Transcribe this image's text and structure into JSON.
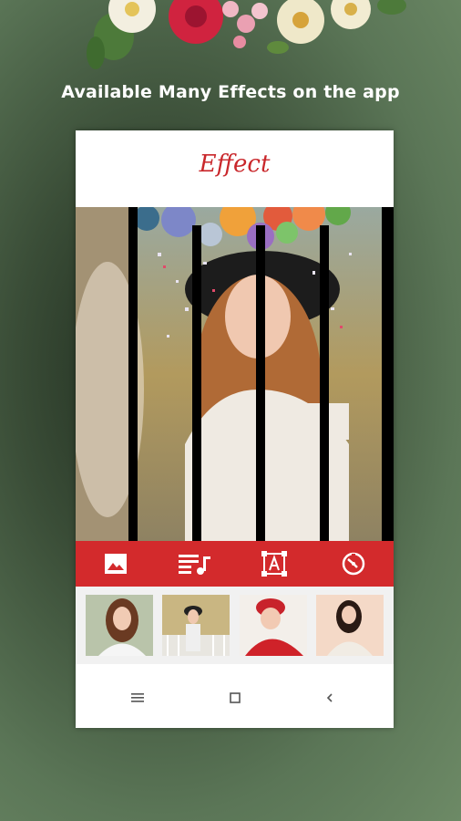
{
  "promo": {
    "headline": "Available Many Effects on the app"
  },
  "app": {
    "title": "Effect"
  },
  "toolbar": {
    "items": [
      {
        "icon": "image-icon"
      },
      {
        "icon": "music-list-icon"
      },
      {
        "icon": "text-frame-icon"
      },
      {
        "icon": "timer-icon"
      }
    ]
  },
  "thumbnails": [
    {
      "icon": "photo-thumbnail"
    },
    {
      "icon": "photo-thumbnail"
    },
    {
      "icon": "photo-thumbnail"
    },
    {
      "icon": "photo-thumbnail"
    }
  ],
  "navbar": {
    "icons": [
      "menu-icon",
      "home-square-icon",
      "back-chevron-icon"
    ]
  },
  "colors": {
    "accent": "#d32a2c",
    "title": "#c9272b",
    "background": "#5b7657"
  }
}
